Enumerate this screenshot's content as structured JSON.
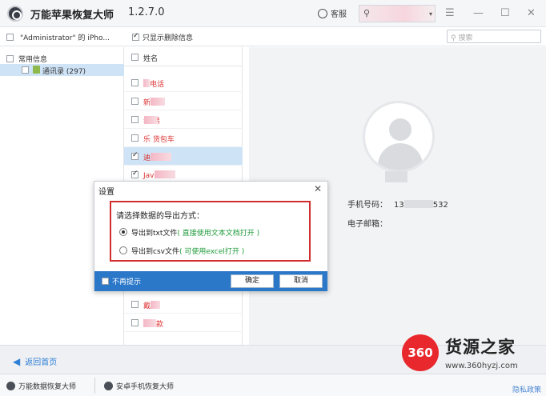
{
  "titlebar": {
    "title": "万能苹果恢复大师",
    "version": "1.2.7.0",
    "service_label": "客服",
    "icons": [
      "app-logo",
      "service-chat-icon",
      "user-icon",
      "menu-icon",
      "minimize-icon",
      "maximize-icon",
      "close-icon"
    ]
  },
  "toolbar": {
    "device_label": "\"Administrator\" 的 iPho...",
    "only_deleted_label": "只显示删除信息",
    "only_deleted_checked": true,
    "search_placeholder": "搜索"
  },
  "tree": {
    "group_label": "常用信息",
    "child_label": "通讯录 (297)"
  },
  "list": {
    "header": "姓名",
    "rows": [
      {
        "text_visible": "电话",
        "checked": false,
        "selected": false
      },
      {
        "text_visible": "新",
        "checked": false,
        "selected": false
      },
      {
        "text_visible": "老 弟",
        "checked": false,
        "selected": false
      },
      {
        "text_visible": "乐 货包车",
        "checked": false,
        "selected": false
      },
      {
        "text_visible": "迪",
        "checked": true,
        "selected": true
      },
      {
        "text_visible": "Jav",
        "checked": true,
        "selected": false
      },
      {
        "text_visible": "戴",
        "checked": false,
        "selected": false
      },
      {
        "text_visible": "款",
        "checked": false,
        "selected": false
      }
    ]
  },
  "detail": {
    "phone_label": "手机号码：",
    "phone_prefix": "13",
    "phone_suffix": "532",
    "email_label": "电子邮箱："
  },
  "dialog": {
    "title": "设置",
    "prompt": "请选择数据的导出方式：",
    "option1": "导出到txt文件",
    "option1_hint": "( 直接使用文本文档打开 )",
    "option2": "导出到csv文件",
    "option2_hint": "( 可使用excel打开 )",
    "selected_option": 1,
    "no_prompt_label": "不再提示",
    "ok_label": "确定",
    "cancel_label": "取消"
  },
  "bottom": {
    "back_label": "返回首页",
    "footer_item1": "万能数据恢复大师",
    "footer_item2": "安卓手机恢复大师",
    "privacy_label": "隐私政策"
  },
  "watermark": {
    "badge": "360",
    "text": "货源之家",
    "url": "www.360hyzj.com"
  },
  "colors": {
    "accent_blue": "#2b78c9",
    "highlight_red": "#d22d2d",
    "hint_green": "#1e9a3a",
    "selection": "#cfe3f6"
  }
}
